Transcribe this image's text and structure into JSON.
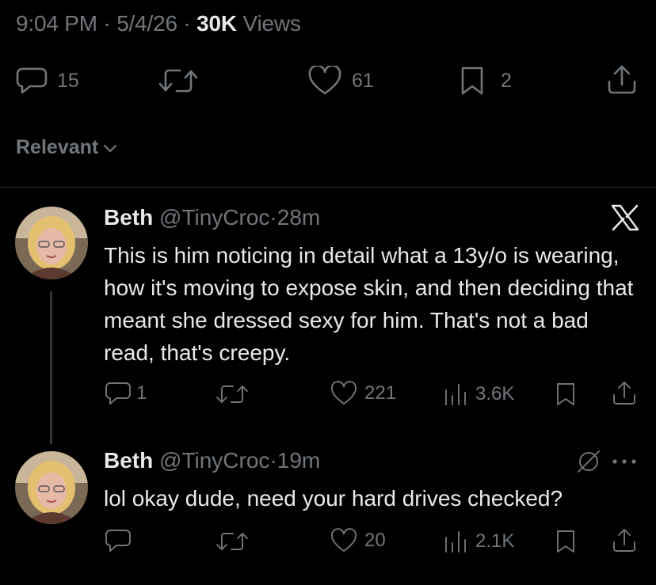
{
  "post_meta": {
    "time": "9:04 PM",
    "date": "5/4/26",
    "views_count": "30K",
    "views_label": "Views"
  },
  "post_actions": {
    "replies": "15",
    "likes": "61",
    "bookmarks": "2"
  },
  "sort": {
    "label": "Relevant"
  },
  "replies": [
    {
      "name": "Beth",
      "handle": "@TinyCroc",
      "time": "28m",
      "text": "This is him noticing in detail what a 13y/o is wearing, how it's moving to expose skin, and then deciding that meant she dressed sexy for him. That's not a bad read, that's creepy.",
      "reply_count": "1",
      "like_count": "221",
      "view_count": "3.6K",
      "badge_icon": "x-logo-icon"
    },
    {
      "name": "Beth",
      "handle": "@TinyCroc",
      "time": "19m",
      "text": "lol okay dude, need your hard drives checked?",
      "reply_count": "",
      "like_count": "20",
      "view_count": "2.1K",
      "badge_icon": "mute-icon"
    }
  ],
  "colors": {
    "background": "#000000",
    "text": "#e7e9ea",
    "muted": "#71767b",
    "divider": "#2f3336"
  }
}
